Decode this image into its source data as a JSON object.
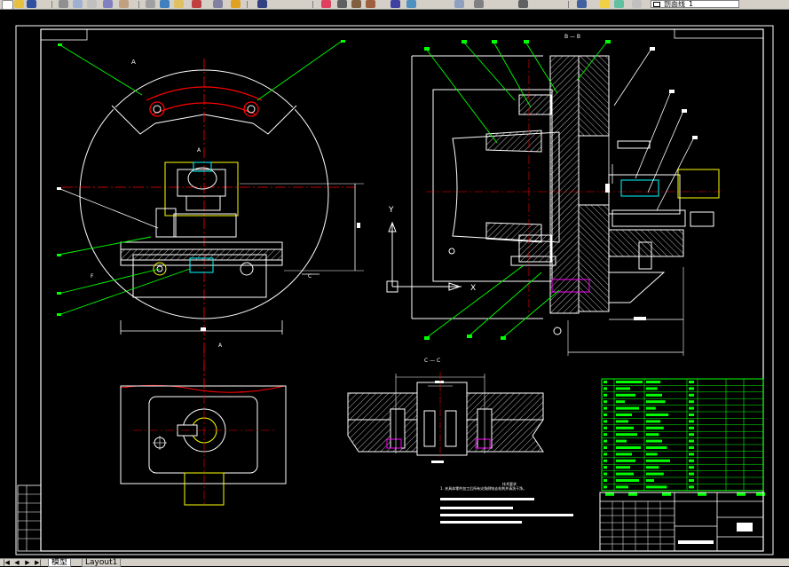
{
  "toolbar": {
    "layer_name": "剖面线_1",
    "icons": [
      "new-icon",
      "open-icon",
      "save-icon",
      "print-icon",
      "preview-icon",
      "plot-icon",
      "cut-icon",
      "copy-icon",
      "paste-icon",
      "match-icon",
      "undo-icon",
      "redo-icon",
      "pan-icon",
      "zoom-realtime-icon",
      "zoom-window-icon",
      "zoom-previous-icon",
      "properties-icon",
      "design-center-icon",
      "tool-palette-icon",
      "calculator-icon",
      "layer-manager-icon",
      "layer-state-icon",
      "bulb-icon",
      "sun-icon",
      "lock-icon"
    ]
  },
  "drawing": {
    "section_label_top": "B — B",
    "section_label_cc": "C — C",
    "note_heading": "技术要求",
    "note_line_1": "1. 夹具体零件加工后所有尖角倒钝去毛刺并清洗干净。",
    "axis_y": "Y",
    "axis_x": "X"
  },
  "tabs": {
    "model": "模型",
    "layout1": "Layout1"
  },
  "colors": {
    "background": "#000000",
    "outline": "#ffffff",
    "centerline": "#ff0000",
    "leader": "#00ff00",
    "highlight": "#ffff00",
    "cyan": "#00ffff",
    "magenta": "#ff00ff"
  }
}
